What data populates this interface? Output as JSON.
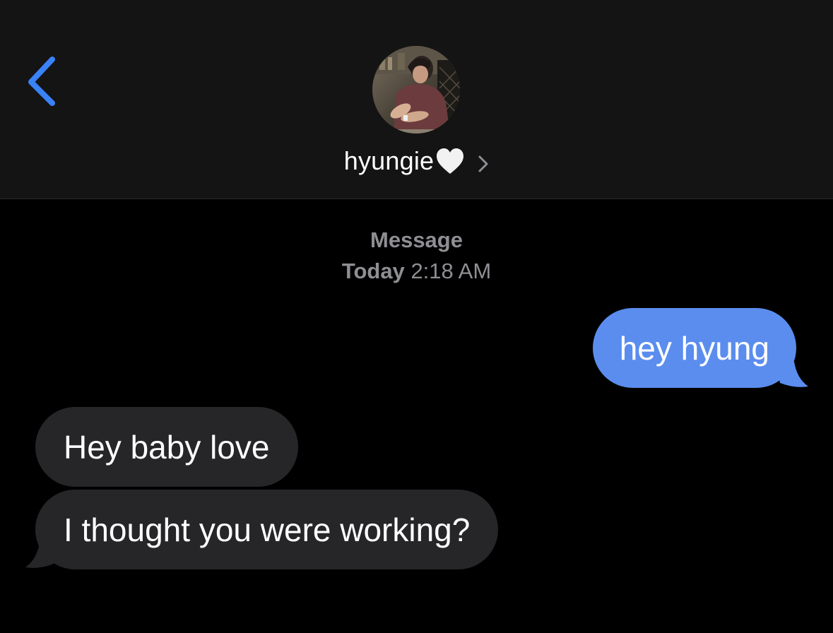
{
  "header": {
    "contact_name": "hyungie",
    "colors": {
      "accent": "#3a82f7",
      "header_bg": "#141414"
    },
    "icons": {
      "back": "chevron-left-icon",
      "heart": "white-heart-icon",
      "details": "chevron-right-icon"
    }
  },
  "thread": {
    "service_label": "Message",
    "date_label": "Today",
    "time_label": "2:18 AM",
    "messages": [
      {
        "direction": "sent",
        "text": "hey hyung",
        "color": "#5b8def"
      },
      {
        "direction": "received",
        "text": "Hey baby love",
        "color": "#262628"
      },
      {
        "direction": "received",
        "text": "I thought you were working?",
        "color": "#262628"
      }
    ]
  }
}
